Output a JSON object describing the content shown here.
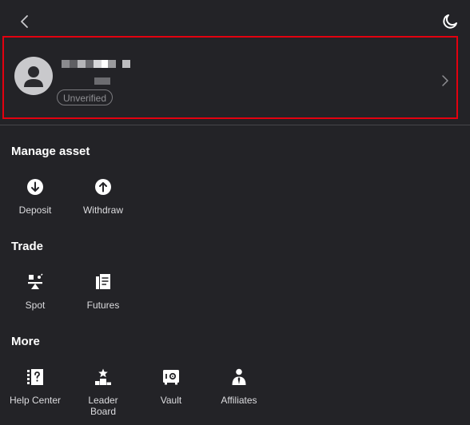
{
  "profile": {
    "status_badge": "Unverified"
  },
  "sections": {
    "manage_asset": {
      "title": "Manage asset",
      "deposit": "Deposit",
      "withdraw": "Withdraw"
    },
    "trade": {
      "title": "Trade",
      "spot": "Spot",
      "futures": "Futures"
    },
    "more": {
      "title": "More",
      "help_center": "Help Center",
      "leader_board": "Leader Board",
      "vault": "Vault",
      "affiliates": "Affiliates"
    }
  },
  "icons": {
    "back": "chevron-left-icon",
    "theme": "moon-icon",
    "avatar": "user-avatar-icon",
    "card_chevron": "chevron-right-icon",
    "deposit": "arrow-down-circle-icon",
    "withdraw": "arrow-up-circle-icon",
    "spot": "spot-scale-icon",
    "futures": "document-stack-icon",
    "help_center": "help-question-icon",
    "leader_board": "podium-star-icon",
    "vault": "safe-icon",
    "affiliates": "person-tie-icon"
  },
  "colors": {
    "background": "#232327",
    "highlight_border": "#e3000f",
    "text_primary": "#ffffff",
    "text_secondary": "#dcdcdf",
    "muted": "#8f8f93"
  }
}
